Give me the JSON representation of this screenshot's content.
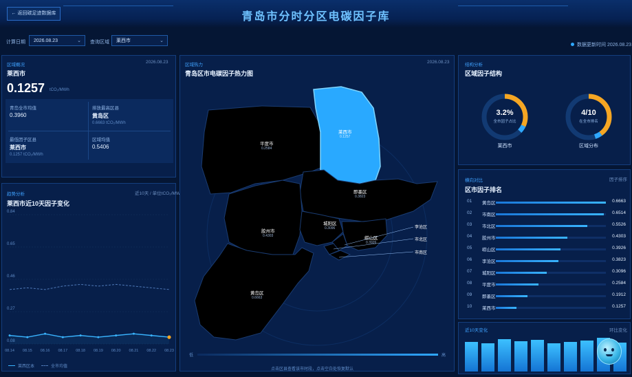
{
  "header": {
    "title": "青岛市分时分区电碳因子库",
    "back_label": "← 返回碳足迹数据库"
  },
  "filters": {
    "date_label": "计算日期",
    "date_value": "2026.08.23",
    "area_label": "查询区域",
    "area_value": "莱西市",
    "update_text": "数据更新时间 2026.08.23"
  },
  "overview": {
    "tag": "区域概况",
    "date": "2026.08.23",
    "name": "莱西市",
    "value": "0.1257",
    "unit": "tCO₂/MWh",
    "cells": [
      {
        "label": "青岛全市均值",
        "value": "0.3960",
        "sub": ""
      },
      {
        "label": "排放最高区县",
        "value": "黄岛区",
        "sub": "0.6663 tCO₂/MWh"
      },
      {
        "label": "最低因子区县",
        "value": "莱西市",
        "sub": "0.1257 tCO₂/MWh"
      },
      {
        "label": "区域均值",
        "value": "0.5406",
        "sub": ""
      }
    ]
  },
  "trend": {
    "tag": "趋势分析",
    "title": "莱西市近10天因子变化",
    "right_tag": "近10天 / 单位tCO₂/MWh",
    "legend": [
      "莱西区本",
      "全市均值"
    ],
    "colors": {
      "local": "#39b4ff",
      "avg": "#4f79b8"
    }
  },
  "chart_data": {
    "type": "line",
    "x": [
      "08.14",
      "08.15",
      "08.16",
      "08.17",
      "08.18",
      "08.19",
      "08.20",
      "08.21",
      "08.22",
      "08.23"
    ],
    "yticks": [
      "0.84",
      "0.65",
      "0.46",
      "0.27",
      "0.08"
    ],
    "ylim": [
      0.08,
      0.84
    ],
    "series": [
      {
        "name": "莱西区本",
        "values": [
          0.13,
          0.12,
          0.14,
          0.12,
          0.13,
          0.12,
          0.13,
          0.14,
          0.13,
          0.12
        ]
      },
      {
        "name": "全市均值",
        "values": [
          0.4,
          0.41,
          0.4,
          0.42,
          0.43,
          0.42,
          0.43,
          0.42,
          0.41,
          0.4
        ]
      }
    ]
  },
  "map": {
    "tag": "区域热力",
    "title": "青岛区市电碳因子热力图",
    "date": "2026.08.23",
    "legend_low": "低",
    "legend_high": "高",
    "hint": "点击区县查看该市时段，点击空白处恢复默认",
    "regions": [
      {
        "name": "莱西市",
        "value": "0.1257"
      },
      {
        "name": "平度市",
        "value": "0.2584"
      },
      {
        "name": "即墨区",
        "value": "0.3823"
      },
      {
        "name": "胶州市",
        "value": "0.4303"
      },
      {
        "name": "城阳区",
        "value": "0.3096"
      },
      {
        "name": "崂山区",
        "value": "0.3926"
      },
      {
        "name": "黄岛区",
        "value": "0.6663"
      },
      {
        "name": "李沧区",
        "value": ""
      },
      {
        "name": "市北区",
        "value": ""
      },
      {
        "name": "市南区",
        "value": ""
      }
    ]
  },
  "structure": {
    "tag": "结构分析",
    "title": "区域因子结构",
    "donut1": {
      "value": "3.2%",
      "sub": "全市因子占比",
      "caption": "莱西市",
      "fraction": 0.32
    },
    "donut2": {
      "value": "4/10",
      "sub": "在全市排名",
      "caption": "区域分布",
      "fraction": 0.4
    }
  },
  "ranking": {
    "tag": "横向对比",
    "title": "区市因子排名",
    "right_tag": "因子排序",
    "items": [
      {
        "rank": "01",
        "name": "黄岛区",
        "value": "0.6663",
        "fraction": 1.0
      },
      {
        "rank": "02",
        "name": "市南区",
        "value": "0.6514",
        "fraction": 0.98
      },
      {
        "rank": "03",
        "name": "市北区",
        "value": "0.5526",
        "fraction": 0.83
      },
      {
        "rank": "04",
        "name": "胶州市",
        "value": "0.4303",
        "fraction": 0.65
      },
      {
        "rank": "05",
        "name": "崂山区",
        "value": "0.3926",
        "fraction": 0.59
      },
      {
        "rank": "06",
        "name": "李沧区",
        "value": "0.3823",
        "fraction": 0.57
      },
      {
        "rank": "07",
        "name": "城阳区",
        "value": "0.3096",
        "fraction": 0.46
      },
      {
        "rank": "08",
        "name": "平度市",
        "value": "0.2584",
        "fraction": 0.39
      },
      {
        "rank": "09",
        "name": "即墨区",
        "value": "0.1912",
        "fraction": 0.29
      },
      {
        "rank": "10",
        "name": "莱西市",
        "value": "0.1257",
        "fraction": 0.19
      }
    ]
  },
  "bars10": {
    "title": "近10天变化",
    "right_tag": "环比变化",
    "values": [
      0.82,
      0.78,
      0.9,
      0.84,
      0.88,
      0.79,
      0.83,
      0.86,
      0.95,
      0.8
    ]
  }
}
